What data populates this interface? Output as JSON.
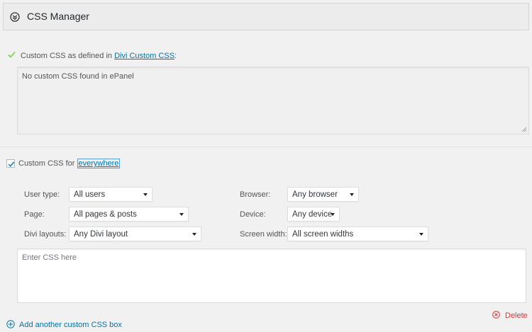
{
  "header": {
    "title": "CSS Manager"
  },
  "section1": {
    "label_prefix": "Custom CSS as defined in ",
    "link_text": "Divi Custom CSS",
    "label_suffix": ":",
    "textarea_value": "No custom CSS found in ePanel"
  },
  "section2": {
    "label_prefix": "Custom CSS for ",
    "link_text": "everywhere",
    "checked": true
  },
  "filters": {
    "user_type": {
      "label": "User type:",
      "value": "All users"
    },
    "page": {
      "label": "Page:",
      "value": "All pages & posts"
    },
    "divi_layouts": {
      "label": "Divi layouts:",
      "value": "Any Divi layout"
    },
    "browser": {
      "label": "Browser:",
      "value": "Any browser"
    },
    "device": {
      "label": "Device:",
      "value": "Any device"
    },
    "screen_width": {
      "label": "Screen width:",
      "value": "All screen widths"
    }
  },
  "css_box": {
    "placeholder": "Enter CSS here"
  },
  "actions": {
    "delete_label": "Delete",
    "add_label": "Add another custom CSS box"
  },
  "colors": {
    "link": "#0073aa",
    "delete": "#dc3232",
    "check_green": "#7ad03a"
  }
}
